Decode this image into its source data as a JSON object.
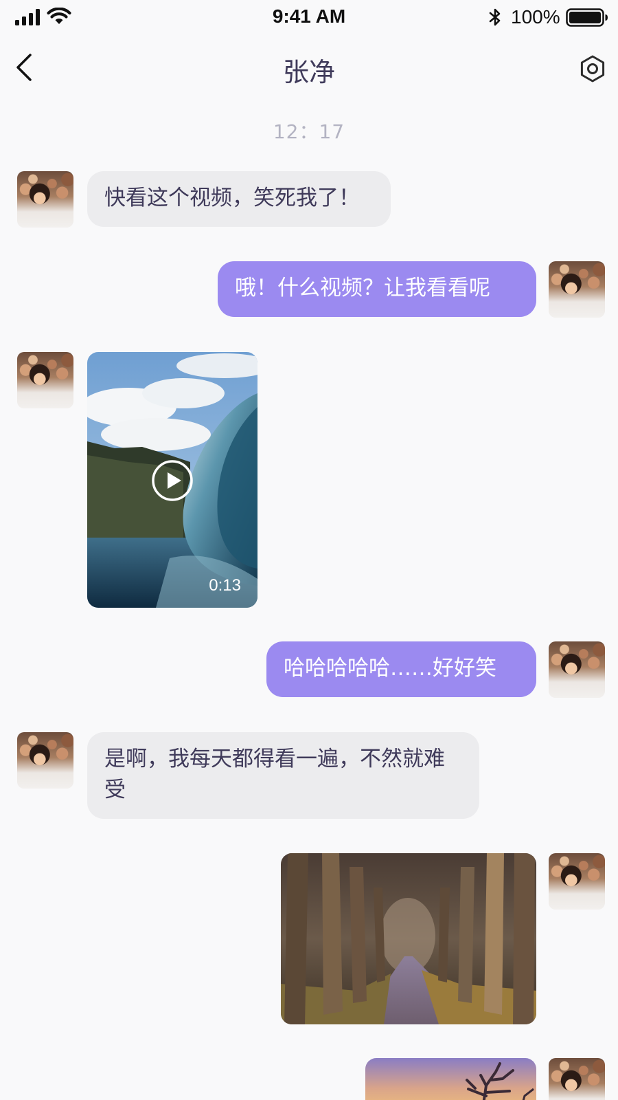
{
  "status_bar": {
    "time": "9:41 AM",
    "battery": "100%",
    "icons": [
      "signal-icon",
      "wifi-icon",
      "bluetooth-icon",
      "battery-icon"
    ]
  },
  "nav": {
    "title": "张净",
    "back_icon": "chevron-left-icon",
    "settings_icon": "gear-icon"
  },
  "timestamp": "12：17",
  "messages": [
    {
      "side": "in",
      "type": "text",
      "text": "快看这个视频，笑死我了！"
    },
    {
      "side": "out",
      "type": "text",
      "text": "哦！什么视频？让我看看呢"
    },
    {
      "side": "in",
      "type": "video",
      "duration": "0:13",
      "content": "ocean wave video thumbnail"
    },
    {
      "side": "out",
      "type": "text",
      "text": "哈哈哈哈哈……好好笑"
    },
    {
      "side": "in",
      "type": "text",
      "text": "是啊，我每天都得看一遍，不然就难受"
    },
    {
      "side": "out",
      "type": "image",
      "content": "tree-lined forest path photo"
    },
    {
      "side": "out",
      "type": "image",
      "content": "sunset photo"
    }
  ],
  "colors": {
    "background": "#f9f9fa",
    "incoming_bubble": "#ececee",
    "outgoing_bubble": "#9b8af0",
    "text": "#3f3a5a",
    "timestamp": "#b3b3c2"
  }
}
